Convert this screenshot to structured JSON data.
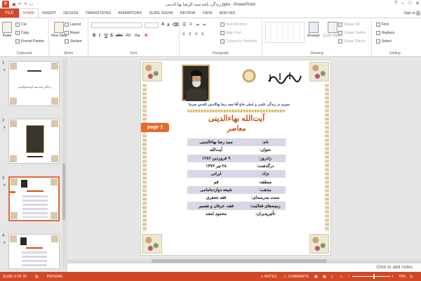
{
  "window": {
    "title": "زندگی نامه سید الرضا بها الدینی.pptx - PowerPoint",
    "app_letter": "P",
    "controls": [
      "?",
      "–",
      "□",
      "✕"
    ]
  },
  "tabs": {
    "file": "FILE",
    "items": [
      "HOME",
      "INSERT",
      "DESIGN",
      "TRANSITIONS",
      "ANIMATIONS",
      "SLIDE SHOW",
      "REVIEW",
      "VIEW",
      "ADD-INS"
    ],
    "active": "HOME",
    "signin": "Sign in"
  },
  "ribbon": {
    "clipboard": {
      "label": "Clipboard",
      "paste": "Paste",
      "cut": "Cut",
      "copy": "Copy",
      "format_painter": "Format Painter"
    },
    "slides": {
      "label": "Slides",
      "new_slide": "New Slide",
      "layout": "Layout",
      "reset": "Reset",
      "section": "Section"
    },
    "font": {
      "label": "Font",
      "bold": "B",
      "italic": "I",
      "underline": "U",
      "shadow": "S",
      "strike": "abc",
      "spacing": "AV",
      "case": "Aa",
      "color": "A"
    },
    "paragraph": {
      "label": "Paragraph",
      "text_direction": "Text Direction",
      "align_text": "Align Text",
      "convert_smartart": "Convert to SmartArt"
    },
    "drawing": {
      "label": "Drawing",
      "arrange": "Arrange",
      "quick_styles": "Quick Styles",
      "shape_fill": "Shape Fill",
      "shape_outline": "Shape Outline",
      "shape_effects": "Shape Effects"
    },
    "editing": {
      "label": "Editing",
      "find": "Find",
      "replace": "Replace",
      "select": "Select"
    }
  },
  "thumbnails": [
    {
      "num": "1",
      "caption": "زندگانی نامه سید الرضا بهاالدینی"
    },
    {
      "num": "2",
      "caption": ""
    },
    {
      "num": "3",
      "caption": ""
    },
    {
      "num": "4",
      "caption": ""
    }
  ],
  "slide": {
    "subtitle": "سیری در زندگی علمی و عملی حاج آقا سید رضا بهاالدینی (قدس سره)",
    "title": "آیت‌الله بهاءالدینی",
    "title2": "معاصر",
    "page_badge": "page 1",
    "rows": [
      {
        "label": "نام:",
        "value": "سید رضا بهاءالدینی"
      },
      {
        "label": "عنوان:",
        "value": "آیت‌الله"
      },
      {
        "label": "زادروز:",
        "value": "۹ فروردین ۱۲۸۶"
      },
      {
        "label": "درگذشت:",
        "value": "۲۸ تیر ۱۳۷۶"
      },
      {
        "label": "نژاد:",
        "value": "ایرانی"
      },
      {
        "label": "منطقه:",
        "value": "قم"
      },
      {
        "label": "مذهب:",
        "value": "شیعه دوازده‌امامی"
      },
      {
        "label": "سنت مدرسه‌ای:",
        "value": "فقه جعفری"
      },
      {
        "label": "زمینه‌های فعالیت:",
        "value": "فقه، عرفان و تفسیر"
      },
      {
        "label": "تأثیرپذیران:",
        "value": "محمود امجد"
      }
    ]
  },
  "notes": {
    "placeholder": "Click to add notes"
  },
  "status": {
    "slide": "SLIDE 3 OF 33",
    "language": "PERSIAN",
    "notes": "NOTES",
    "comments": "COMMENTS",
    "zoom": "70%"
  }
}
